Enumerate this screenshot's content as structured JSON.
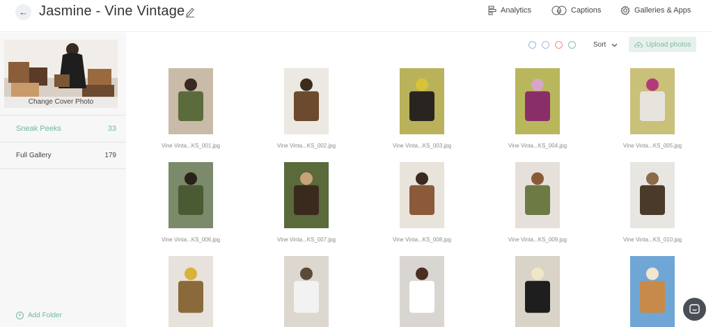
{
  "header": {
    "title": "Jasmine - Vine Vintage",
    "back_icon": "arrow-left-icon",
    "nav": {
      "analytics": "Analytics",
      "captions": "Captions",
      "galleries": "Galleries & Apps"
    }
  },
  "sidebar": {
    "cover_label": "Change Cover Photo",
    "folders": [
      {
        "label": "Sneak Peeks",
        "count": "33",
        "active": true
      },
      {
        "label": "Full Gallery",
        "count": "179",
        "active": false
      }
    ],
    "add_folder": "Add Folder"
  },
  "toolbar": {
    "color_dots": [
      "#8fb4e6",
      "#b7aee6",
      "#e98b8b",
      "#7fc4a5"
    ],
    "sort_label": "Sort",
    "upload_label": "Upload photos"
  },
  "colors": {
    "accent": "#6fb89a",
    "upload_bg": "#e6f1ec"
  },
  "photos": [
    {
      "file": "Vine Vinta...KS_001.jpg"
    },
    {
      "file": "Vine Vinta...KS_002.jpg"
    },
    {
      "file": "Vine Vinta...KS_003.jpg"
    },
    {
      "file": "Vine Vinta...KS_004.jpg"
    },
    {
      "file": "Vine Vinta...KS_005.jpg"
    },
    {
      "file": "Vine Vinta...KS_006.jpg"
    },
    {
      "file": "Vine Vinta...KS_007.jpg"
    },
    {
      "file": "Vine Vinta...KS_008.jpg"
    },
    {
      "file": "Vine Vinta...KS_009.jpg"
    },
    {
      "file": "Vine Vinta...KS_010.jpg"
    },
    {
      "file": ""
    },
    {
      "file": ""
    },
    {
      "file": ""
    },
    {
      "file": ""
    },
    {
      "file": ""
    }
  ]
}
